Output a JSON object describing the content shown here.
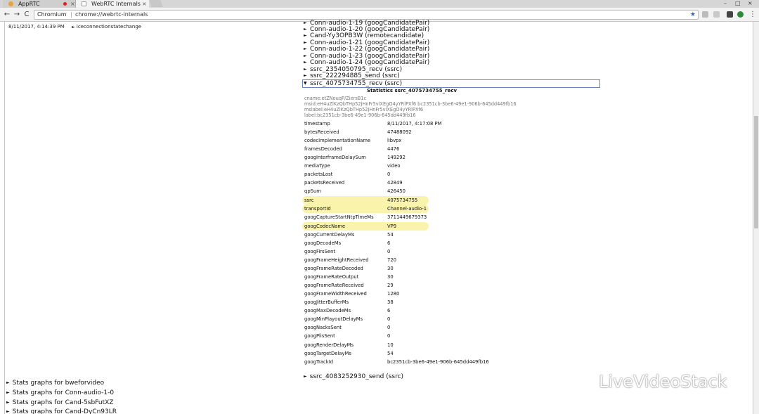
{
  "browser": {
    "tabs": [
      {
        "title": "AppRTC",
        "active": false
      },
      {
        "title": "WebRTC Internals",
        "active": true
      }
    ],
    "window_controls": [
      "–",
      "□",
      "×"
    ],
    "site_chip": "Chromium",
    "url": "chrome://webrtc-internals",
    "nav": {
      "back": "←",
      "forward": "→",
      "reload": "C"
    },
    "bookmark_star": "★"
  },
  "event": {
    "time": "8/11/2017, 4:14:39 PM",
    "label": "iceconnectionstatechange"
  },
  "tree_items": [
    "Conn-audio-1-19 (googCandidatePair)",
    "Conn-audio-1-20 (googCandidatePair)",
    "Cand-Yy3OPB3W (remotecandidate)",
    "Conn-audio-1-21 (googCandidatePair)",
    "Conn-audio-1-22 (googCandidatePair)",
    "Conn-audio-1-23 (googCandidatePair)",
    "Conn-audio-1-24 (googCandidatePair)",
    "ssrc_2354050795_recv (ssrc)",
    "ssrc_222294885_send (ssrc)"
  ],
  "open_item": "ssrc_4075734755_recv (ssrc)",
  "stats_title": "Statistics ssrc_4075734755_recv",
  "meta_lines": [
    "cname:etZNouqP/ZiersB1c",
    "msid:eH4uZlKzQbTHp52jHnFr5vlXEgO4yYRlPXf6 bc2351cb-3be6-49e1-906b-645dd449fb16",
    "mslabel:eH4uZlKzQbTHp52jHnFr5vlXEgO4yYRlPXf6",
    "label:bc2351cb-3be6-49e1-906b-645dd449fb16"
  ],
  "stats": [
    {
      "key": "timestamp",
      "value": "8/11/2017, 4:17:08 PM"
    },
    {
      "key": "bytesReceived",
      "value": "47488092"
    },
    {
      "key": "codecImplementationName",
      "value": "libvpx"
    },
    {
      "key": "framesDecoded",
      "value": "4476"
    },
    {
      "key": "googInterframeDelaySum",
      "value": "149292"
    },
    {
      "key": "mediaType",
      "value": "video"
    },
    {
      "key": "packetsLost",
      "value": "0"
    },
    {
      "key": "packetsReceived",
      "value": "42849"
    },
    {
      "key": "qpSum",
      "value": "426450"
    },
    {
      "key": "ssrc",
      "value": "4075734755",
      "highlight": true
    },
    {
      "key": "transportId",
      "value": "Channel-audio-1",
      "highlight": true
    },
    {
      "key": "googCaptureStartNtpTimeMs",
      "value": "3711449679373"
    },
    {
      "key": "googCodecName",
      "value": "VP9",
      "highlight": true
    },
    {
      "key": "googCurrentDelayMs",
      "value": "54"
    },
    {
      "key": "googDecodeMs",
      "value": "6"
    },
    {
      "key": "googFirsSent",
      "value": "0"
    },
    {
      "key": "googFrameHeightReceived",
      "value": "720"
    },
    {
      "key": "googFrameRateDecoded",
      "value": "30"
    },
    {
      "key": "googFrameRateOutput",
      "value": "30"
    },
    {
      "key": "googFrameRateReceived",
      "value": "29"
    },
    {
      "key": "googFrameWidthReceived",
      "value": "1280"
    },
    {
      "key": "googJitterBufferMs",
      "value": "38"
    },
    {
      "key": "googMaxDecodeMs",
      "value": "6"
    },
    {
      "key": "googMinPlayoutDelayMs",
      "value": "0"
    },
    {
      "key": "googNacksSent",
      "value": "0"
    },
    {
      "key": "googPlisSent",
      "value": "0"
    },
    {
      "key": "googRenderDelayMs",
      "value": "10"
    },
    {
      "key": "googTargetDelayMs",
      "value": "54"
    },
    {
      "key": "googTrackId",
      "value": "bc2351cb-3be6-49e1-906b-645dd449fb16"
    }
  ],
  "highlight_color": "#f9f3ac",
  "next_item": "ssrc_4083252930_send (ssrc)",
  "graph_links": [
    "Stats graphs for bweforvideo",
    "Stats graphs for Conn-audio-1-0",
    "Stats graphs for Cand-5sbFutXZ",
    "Stats graphs for Cand-DyCn93LR"
  ],
  "watermark": "LiveVideoStack"
}
